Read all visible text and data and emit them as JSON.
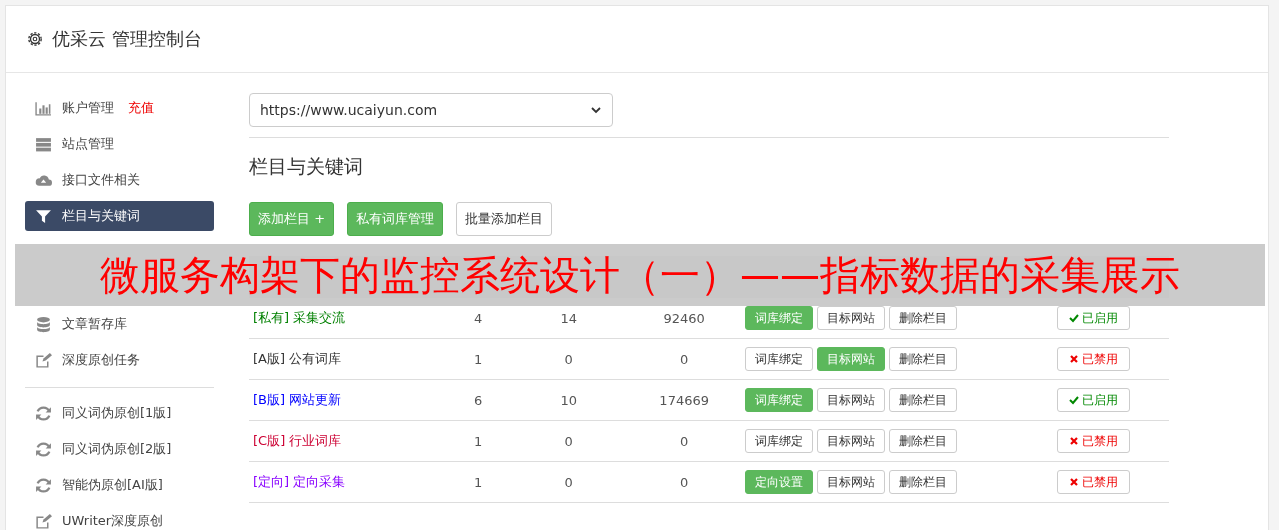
{
  "header": {
    "title": "优采云 管理控制台"
  },
  "sidebar": {
    "items": [
      {
        "label": "账户管理",
        "badge": "充值",
        "selected": false
      },
      {
        "label": "站点管理",
        "selected": false
      },
      {
        "label": "接口文件相关",
        "selected": false
      },
      {
        "label": "栏目与关键词",
        "selected": true
      },
      {
        "label": "文章暂存库",
        "selected": false
      },
      {
        "label": "深度原创任务",
        "selected": false
      }
    ],
    "items_2": [
      {
        "label": "同义词伪原创[1版]",
        "selected": false
      },
      {
        "label": "同义词伪原创[2版]",
        "selected": false
      },
      {
        "label": "智能伪原创[AI版]",
        "selected": false
      },
      {
        "label": "UWriter深度原创",
        "selected": false
      }
    ]
  },
  "site_select": {
    "value": "https://www.ucaiyun.com"
  },
  "section_title": "栏目与关键词",
  "toolbar": [
    {
      "label": "添加栏目 +",
      "primary": true
    },
    {
      "label": "私有词库管理",
      "primary": true
    },
    {
      "label": "批量添加栏目",
      "primary": false
    }
  ],
  "table": {
    "rows": [
      {
        "tag": "[私有]",
        "name": "采集交流",
        "color": "#008000",
        "id": "4",
        "pending": "14",
        "collected": "92460",
        "actions": [
          {
            "label": "词库绑定",
            "active": true
          },
          {
            "label": "目标网站",
            "active": false
          },
          {
            "label": "删除栏目",
            "active": false
          }
        ],
        "enabled": true,
        "status": "已启用"
      },
      {
        "tag": "[A版]",
        "name": "公有词库",
        "color": "#333333",
        "id": "1",
        "pending": "0",
        "collected": "0",
        "actions": [
          {
            "label": "词库绑定",
            "active": false
          },
          {
            "label": "目标网站",
            "active": true
          },
          {
            "label": "删除栏目",
            "active": false
          }
        ],
        "enabled": false,
        "status": "已禁用"
      },
      {
        "tag": "[B版]",
        "name": "网站更新",
        "color": "#0000ff",
        "id": "6",
        "pending": "10",
        "collected": "174669",
        "actions": [
          {
            "label": "词库绑定",
            "active": true
          },
          {
            "label": "目标网站",
            "active": false
          },
          {
            "label": "删除栏目",
            "active": false
          }
        ],
        "enabled": true,
        "status": "已启用"
      },
      {
        "tag": "[C版]",
        "name": "行业词库",
        "color": "#cc0033",
        "id": "1",
        "pending": "0",
        "collected": "0",
        "actions": [
          {
            "label": "词库绑定",
            "active": false
          },
          {
            "label": "目标网站",
            "active": false
          },
          {
            "label": "删除栏目",
            "active": false
          }
        ],
        "enabled": false,
        "status": "已禁用"
      },
      {
        "tag": "[定向]",
        "name": "定向采集",
        "color": "#8800ff",
        "id": "1",
        "pending": "0",
        "collected": "0",
        "actions": [
          {
            "label": "定向设置",
            "active": true
          },
          {
            "label": "目标网站",
            "active": false
          },
          {
            "label": "删除栏目",
            "active": false
          }
        ],
        "enabled": false,
        "status": "已禁用"
      }
    ]
  },
  "banner": {
    "text": "微服务构架下的监控系统设计（一）——指标数据的采集展示"
  }
}
